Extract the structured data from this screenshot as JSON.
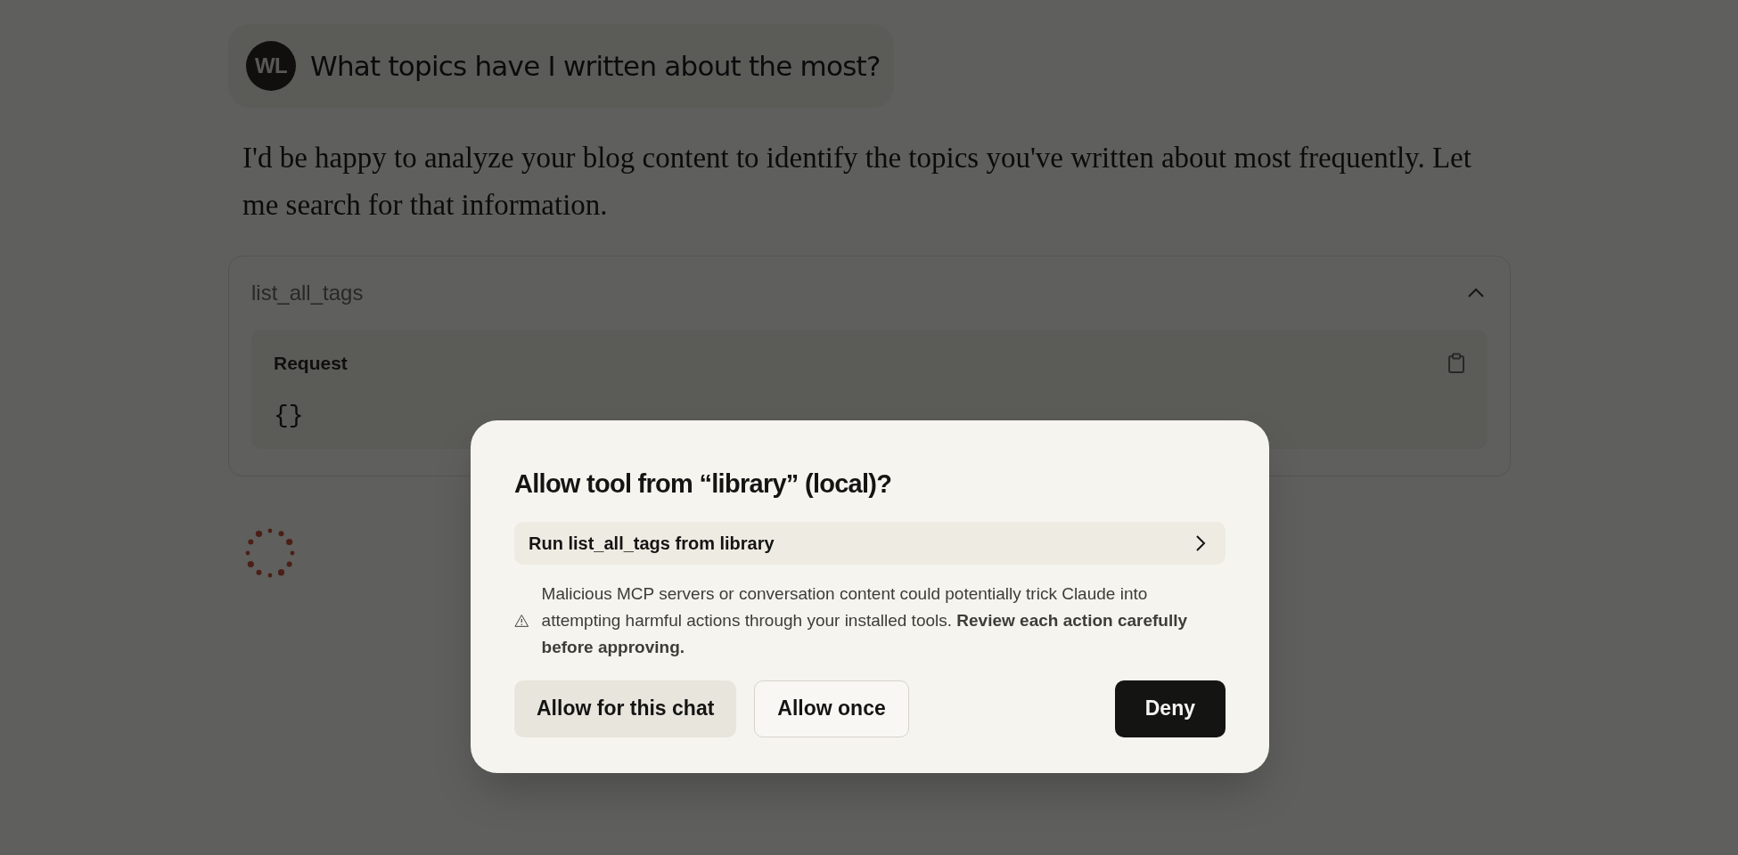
{
  "user_message": {
    "avatar": "WL",
    "text": "What topics have I written about the most?"
  },
  "assistant_message": "I'd be happy to analyze your blog content to identify the topics you've written about most frequently. Let me search for that information.",
  "tool_call": {
    "name": "list_all_tags",
    "expanded": true,
    "request_label": "Request",
    "request_body": "{}"
  },
  "loading": true,
  "dialog": {
    "title": "Allow tool from “library” (local)?",
    "action": "Run list_all_tags from library",
    "warning": "Malicious MCP servers or conversation content could potentially trick Claude into attempting harmful actions through your installed tools. **Review each action carefully before approving.**",
    "buttons": [
      {
        "label": "Allow for this chat",
        "kind": "secondary"
      },
      {
        "label": "Allow once",
        "kind": "outline"
      },
      {
        "label": "Deny",
        "kind": "primary"
      }
    ]
  }
}
